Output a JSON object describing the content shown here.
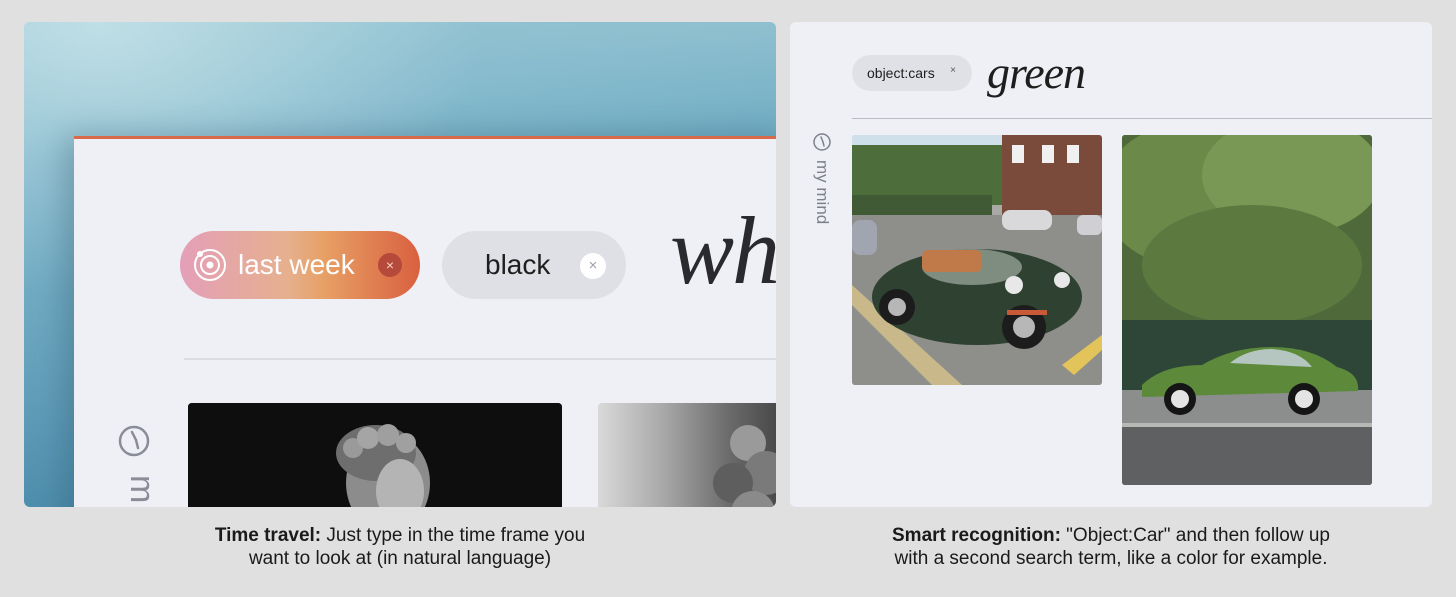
{
  "left_panel": {
    "tags": [
      {
        "label": "last week",
        "remove": "×"
      },
      {
        "label": "black",
        "remove": "×"
      }
    ],
    "query_text": "wh",
    "sidebar_label": "m",
    "caption": {
      "bold": "Time travel:",
      "line1": " Just type in the time frame you",
      "line2": "want to look at (in natural language)"
    }
  },
  "right_panel": {
    "tag": {
      "label": "object:cars",
      "remove": "×"
    },
    "query_text": "green",
    "sidebar_label": "my mind",
    "caption": {
      "bold": "Smart recognition:",
      "line1": " \"Object:Car\" and then follow up",
      "line2": "with a second search term, like a color for example."
    }
  },
  "colors": {
    "accent_orange": "#d9603f",
    "time_gradient_start": "#e49fb8",
    "background": "#eff0f5"
  }
}
